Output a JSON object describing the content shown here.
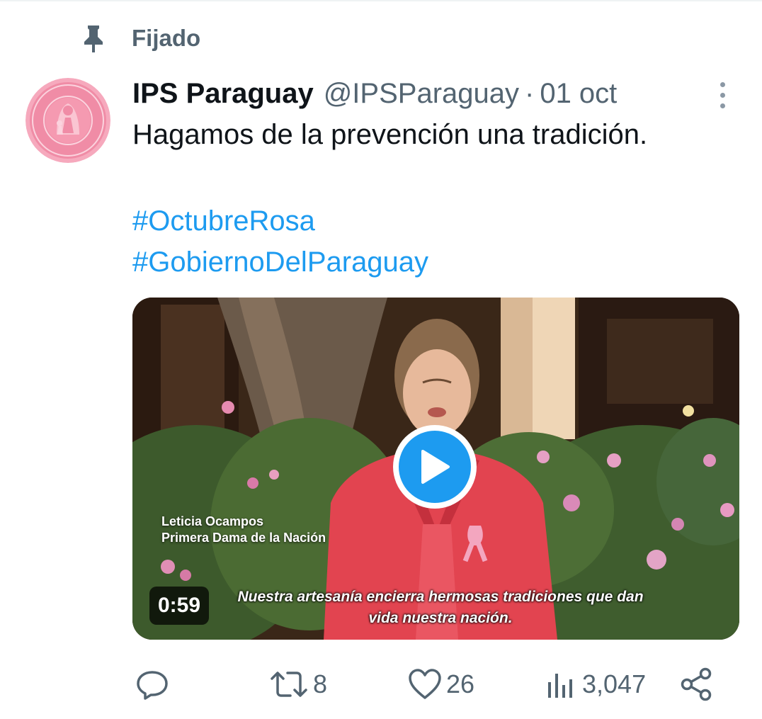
{
  "pinned": {
    "label": "Fijado"
  },
  "author": {
    "display_name": "IPS Paraguay",
    "handle": "@IPSParaguay",
    "separator": "·",
    "date": "01 oct"
  },
  "tweet": {
    "text": "Hagamos de la prevención una tradición.",
    "hashtags": [
      "#OctubreRosa",
      "#GobiernoDelParaguay"
    ]
  },
  "video": {
    "duration": "0:59",
    "caption_name": "Leticia Ocampos",
    "caption_title": "Primera Dama de la Nación",
    "subtitle_line1": "Nuestra artesanía encierra hermosas tradiciones que dan",
    "subtitle_line2": "vida nuestra nación."
  },
  "actions": {
    "reply_icon": "reply-icon",
    "retweet_icon": "retweet-icon",
    "retweet_count": "8",
    "like_icon": "heart-icon",
    "like_count": "26",
    "views_icon": "views-icon",
    "views_count": "3,047",
    "share_icon": "share-icon"
  },
  "colors": {
    "accent": "#1d9bf0",
    "secondary_text": "#536471",
    "avatar_pink": "#f08ca6"
  }
}
